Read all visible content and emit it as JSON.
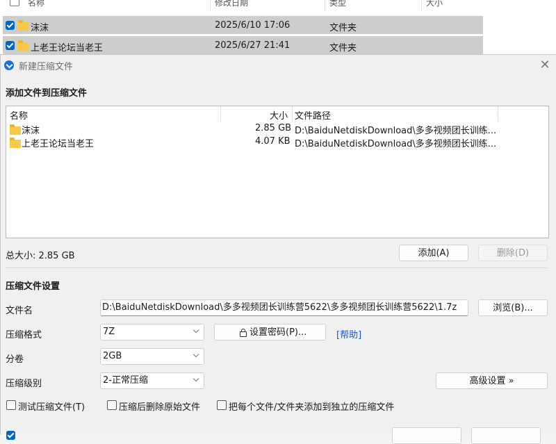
{
  "explorer": {
    "columns": [
      "名称",
      "修改日期",
      "类型",
      "大小"
    ],
    "rows": [
      {
        "name": "沫沫",
        "date": "2025/6/10 17:06",
        "type": "文件夹"
      },
      {
        "name": "上老王论坛当老王",
        "date": "2025/6/27 21:41",
        "type": "文件夹"
      }
    ]
  },
  "dialog": {
    "title": "新建压缩文件",
    "add_section": "添加文件到压缩文件",
    "list_columns": {
      "name": "名称",
      "size": "大小",
      "path": "文件路径"
    },
    "files": [
      {
        "name": "沫沫",
        "size": "2.85 GB",
        "path": "D:\\BaiduNetdiskDownload\\多多视频团长训练..."
      },
      {
        "name": "上老王论坛当老王",
        "size": "4.07 KB",
        "path": "D:\\BaiduNetdiskDownload\\多多视频团长训练..."
      }
    ],
    "total_size": "总大小: 2.85 GB",
    "add_button": "添加(A)",
    "delete_button": "删除(D)",
    "settings_section": "压缩文件设置",
    "filename_label": "文件名",
    "filename_value": "D:\\BaiduNetdiskDownload\\多多视频团长训练营5622\\多多视频团长训练营5622\\1.7z",
    "browse_button": "浏览(B)...",
    "format_label": "压缩格式",
    "format_value": "7Z",
    "password_button": "设置密码(P)...",
    "help_link": "[帮助]",
    "volume_label": "分卷",
    "volume_value": "2GB",
    "level_label": "压缩级别",
    "level_value": "2-正常压缩",
    "advanced_button": "高级设置 »",
    "options": [
      "测试压缩文件(T)",
      "压缩后删除原始文件",
      "把每个文件/文件夹添加到独立的压缩文件"
    ]
  },
  "colors": {
    "accent": "#0067c0",
    "link": "#1a56d6",
    "folder": "#f7c948"
  }
}
